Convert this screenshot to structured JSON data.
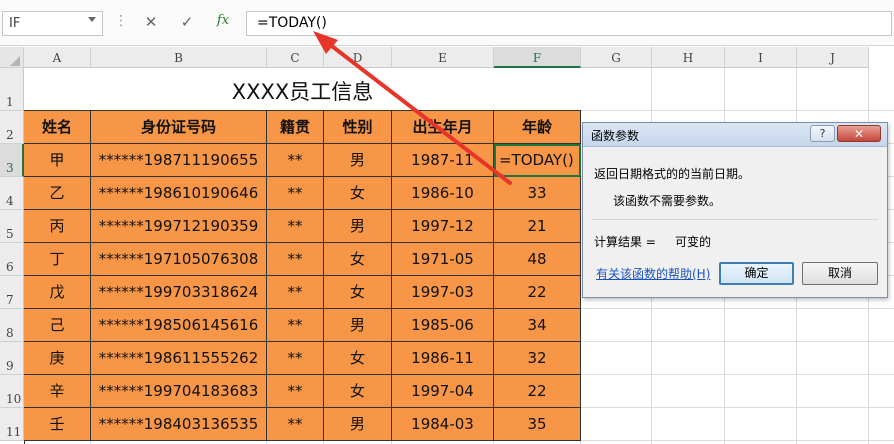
{
  "formula_bar": {
    "name_box": "IF",
    "cancel_glyph": "✕",
    "enter_glyph": "✓",
    "fx_glyph": "fx",
    "formula": "=TODAY()"
  },
  "columns": [
    "A",
    "B",
    "C",
    "D",
    "E",
    "F",
    "G",
    "H",
    "I",
    "J"
  ],
  "rows": [
    "1",
    "2",
    "3",
    "4",
    "5",
    "6",
    "7",
    "8",
    "9",
    "10",
    "11"
  ],
  "sheet": {
    "title": "XXXX员工信息",
    "headers": [
      "姓名",
      "身份证号码",
      "籍贯",
      "性别",
      "出生年月",
      "年龄"
    ],
    "records": [
      [
        "甲",
        "******198711190655",
        "**",
        "男",
        "1987-11",
        "=TODAY()"
      ],
      [
        "乙",
        "******198610190646",
        "**",
        "女",
        "1986-10",
        "33"
      ],
      [
        "丙",
        "******199712190359",
        "**",
        "男",
        "1997-12",
        "21"
      ],
      [
        "丁",
        "******197105076308",
        "**",
        "女",
        "1971-05",
        "48"
      ],
      [
        "戊",
        "******199703318624",
        "**",
        "女",
        "1997-03",
        "22"
      ],
      [
        "己",
        "******198506145616",
        "**",
        "男",
        "1985-06",
        "34"
      ],
      [
        "庚",
        "******198611555262",
        "**",
        "女",
        "1986-11",
        "32"
      ],
      [
        "辛",
        "******199704183683",
        "**",
        "女",
        "1997-04",
        "22"
      ],
      [
        "壬",
        "******198403136535",
        "**",
        "男",
        "1984-03",
        "35"
      ]
    ]
  },
  "dialog": {
    "title": "函数参数",
    "help_button": "?",
    "close_button": "✕",
    "description": "返回日期格式的的当前日期。",
    "note": "该函数不需要参数。",
    "result_label": "计算结果 =",
    "result_value": "可变的",
    "help_link": "有关该函数的帮助(H)",
    "ok": "确定",
    "cancel": "取消"
  },
  "colors": {
    "table_fill": "#f79646",
    "selection": "#217346",
    "annotation_arrow_red": "#e8352a",
    "annotation_arrow_blue": "#2e8ad8"
  }
}
